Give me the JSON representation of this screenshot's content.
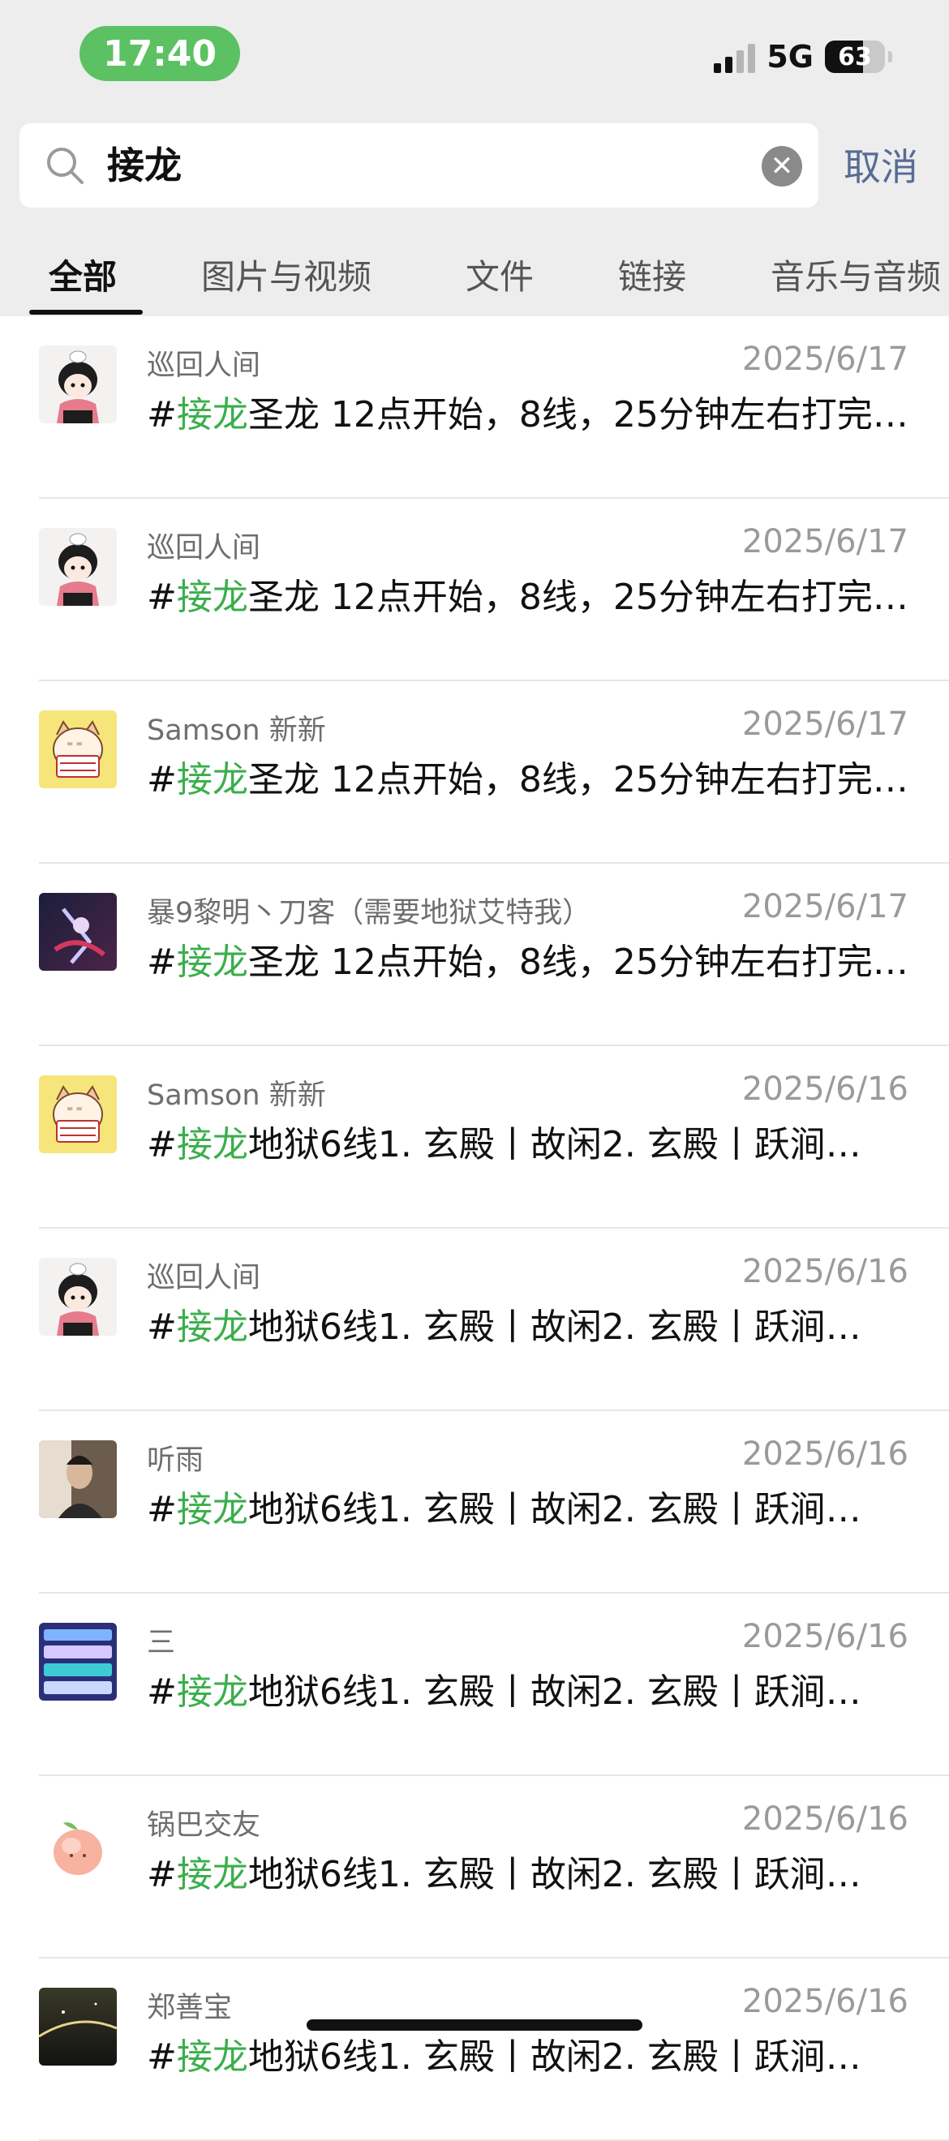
{
  "status_bar": {
    "time": "17:40",
    "network": "5G",
    "battery": "63",
    "battery_level": 0.63
  },
  "search": {
    "value": "接龙",
    "cancel_label": "取消"
  },
  "tabs": [
    "全部",
    "图片与视频",
    "文件",
    "链接",
    "音乐与音频"
  ],
  "active_tab": 0,
  "keyword": "接龙",
  "colors": {
    "highlight": "#3bae4c",
    "time_pill": "#5cc163",
    "cancel": "#576b95"
  },
  "results": [
    {
      "avatar": "boy-avatar",
      "sender": "巡回人间",
      "date": "2025/6/17",
      "prefix": "#",
      "keyword": "接龙",
      "rest": "圣龙 12点开始，8线，25分钟左右打完…"
    },
    {
      "avatar": "boy-avatar",
      "sender": "巡回人间",
      "date": "2025/6/17",
      "prefix": "#",
      "keyword": "接龙",
      "rest": "圣龙 12点开始，8线，25分钟左右打完…"
    },
    {
      "avatar": "cat-sticker-avatar",
      "sender": "Samson 新新",
      "date": "2025/6/17",
      "prefix": "#",
      "keyword": "接龙",
      "rest": "圣龙 12点开始，8线，25分钟左右打完…"
    },
    {
      "avatar": "game-character-avatar",
      "sender": "暴9黎明丶刀客（需要地狱艾特我）",
      "date": "2025/6/17",
      "prefix": "#",
      "keyword": "接龙",
      "rest": "圣龙 12点开始，8线，25分钟左右打完…"
    },
    {
      "avatar": "cat-sticker-avatar",
      "sender": "Samson 新新",
      "date": "2025/6/16",
      "prefix": "#",
      "keyword": "接龙",
      "rest": "地狱6线1. 玄殿丨故闲2. 玄殿丨跃涧…"
    },
    {
      "avatar": "boy-avatar",
      "sender": "巡回人间",
      "date": "2025/6/16",
      "prefix": "#",
      "keyword": "接龙",
      "rest": "地狱6线1. 玄殿丨故闲2. 玄殿丨跃涧…"
    },
    {
      "avatar": "photo-avatar",
      "sender": "听雨",
      "date": "2025/6/16",
      "prefix": "#",
      "keyword": "接龙",
      "rest": "地狱6线1. 玄殿丨故闲2. 玄殿丨跃涧…"
    },
    {
      "avatar": "game-ui-avatar",
      "sender": "三",
      "date": "2025/6/16",
      "prefix": "#",
      "keyword": "接龙",
      "rest": "地狱6线1. 玄殿丨故闲2. 玄殿丨跃涧…"
    },
    {
      "avatar": "peach-avatar",
      "sender": "锅巴交友",
      "date": "2025/6/16",
      "prefix": "#",
      "keyword": "接龙",
      "rest": "地狱6线1. 玄殿丨故闲2. 玄殿丨跃涧…"
    },
    {
      "avatar": "night-sky-avatar",
      "sender": "郑善宝",
      "date": "2025/6/16",
      "prefix": "#",
      "keyword": "接龙",
      "rest": "地狱6线1. 玄殿丨故闲2. 玄殿丨跃涧…"
    }
  ]
}
